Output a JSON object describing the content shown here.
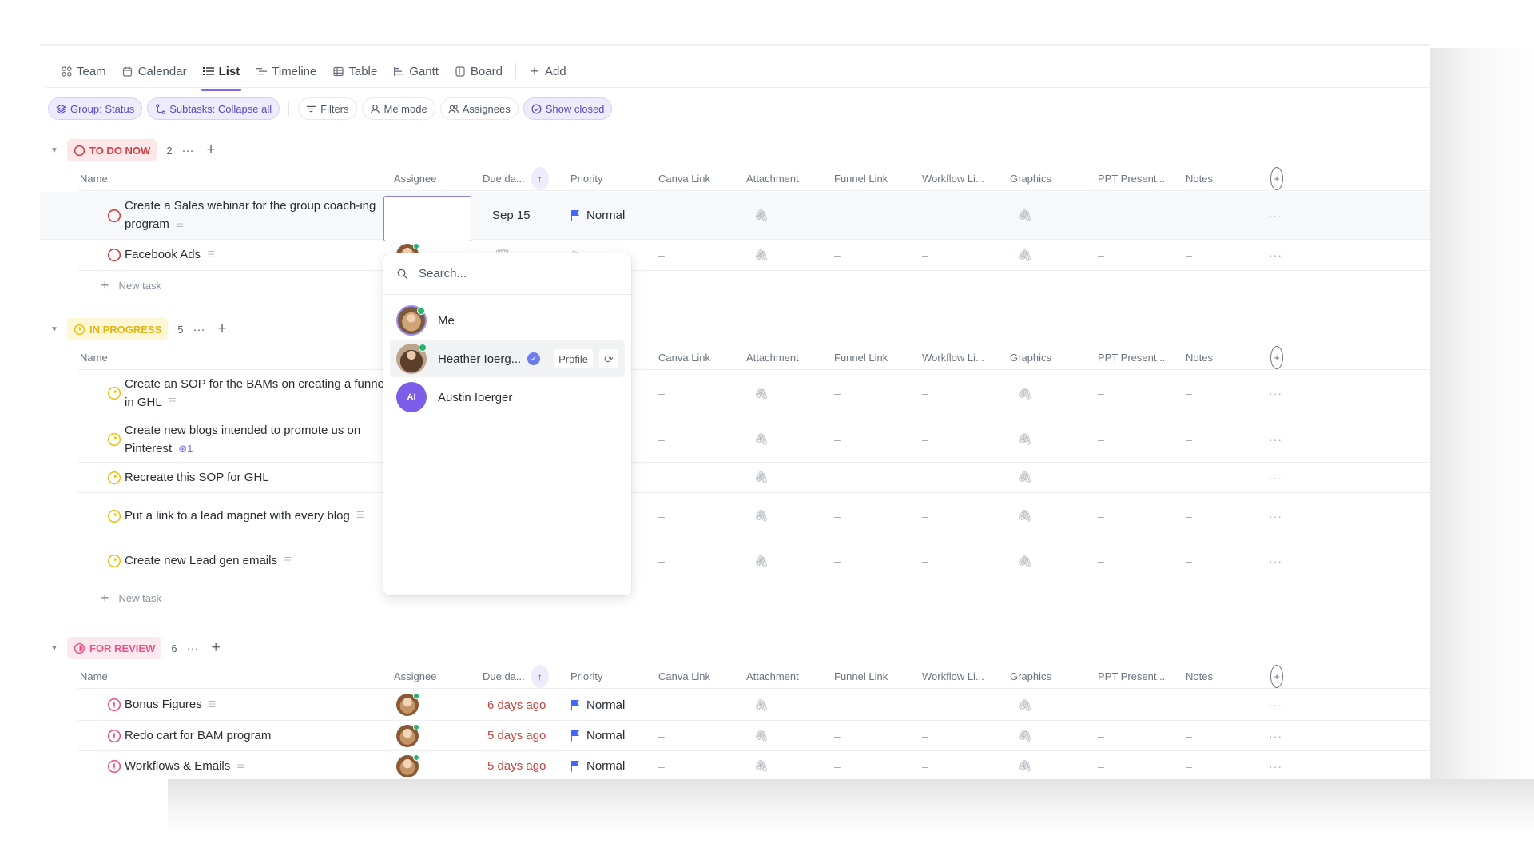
{
  "tabs": [
    {
      "label": "Team",
      "icon": "team-icon",
      "active": false
    },
    {
      "label": "Calendar",
      "icon": "calendar-icon",
      "active": false
    },
    {
      "label": "List",
      "icon": "list-icon",
      "active": true
    },
    {
      "label": "Timeline",
      "icon": "timeline-icon",
      "active": false
    },
    {
      "label": "Table",
      "icon": "table-icon",
      "active": false
    },
    {
      "label": "Gantt",
      "icon": "gantt-icon",
      "active": false
    },
    {
      "label": "Board",
      "icon": "board-icon",
      "active": false
    }
  ],
  "add_tab_label": "Add",
  "chips": {
    "group": "Group: Status",
    "subtasks": "Subtasks: Collapse all",
    "filters": "Filters",
    "me_mode": "Me mode",
    "assignees": "Assignees",
    "show_closed": "Show closed"
  },
  "columns": {
    "name": "Name",
    "assignee": "Assignee",
    "due": "Due da...",
    "priority": "Priority",
    "canva": "Canva Link",
    "attachment": "Attachment",
    "funnel": "Funnel Link",
    "workflow": "Workflow Li...",
    "graphics": "Graphics",
    "ppt": "PPT Present...",
    "notes": "Notes"
  },
  "dash": "–",
  "more": "···",
  "new_task_label": "New task",
  "groups": {
    "todo": {
      "label": "TO DO NOW",
      "count": "2",
      "color": "#d33d44",
      "bg": "#fde7e8",
      "tasks": [
        {
          "name": "Create a Sales webinar for the group coach-ing program",
          "due": "Sep 15",
          "priority": "Normal"
        },
        {
          "name": "Facebook Ads"
        }
      ]
    },
    "progress": {
      "label": "IN PROGRESS",
      "count": "5",
      "color": "#e8c21a",
      "bg": "#fdf7d6",
      "tasks": [
        {
          "name": "Create an SOP for the BAMs on creating a funnel in GHL"
        },
        {
          "name": "Create new blogs intended to promote us on Pinterest",
          "subtasks": "1"
        },
        {
          "name": "Recreate this SOP for GHL"
        },
        {
          "name": "Put a link to a lead magnet with every blog"
        },
        {
          "name": "Create new Lead gen emails"
        }
      ]
    },
    "review": {
      "label": "FOR REVIEW",
      "count": "6",
      "color": "#e8558a",
      "bg": "#fde8f0",
      "tasks": [
        {
          "name": "Bonus Figures",
          "due": "6 days ago",
          "priority": "Normal"
        },
        {
          "name": "Redo cart for BAM program",
          "due": "5 days ago",
          "priority": "Normal"
        },
        {
          "name": "Workflows & Emails",
          "due": "5 days ago",
          "priority": "Normal"
        }
      ]
    }
  },
  "dropdown": {
    "search_placeholder": "Search...",
    "items": [
      {
        "name": "Me",
        "initials": ""
      },
      {
        "name": "Heather Ioerg...",
        "initials": "",
        "profile_label": "Profile"
      },
      {
        "name": "Austin Ioerger",
        "initials": "AI"
      }
    ]
  },
  "colors": {
    "accent": "#7b68ee",
    "priority_flag": "#4466ff",
    "overdue": "#c8423c"
  }
}
